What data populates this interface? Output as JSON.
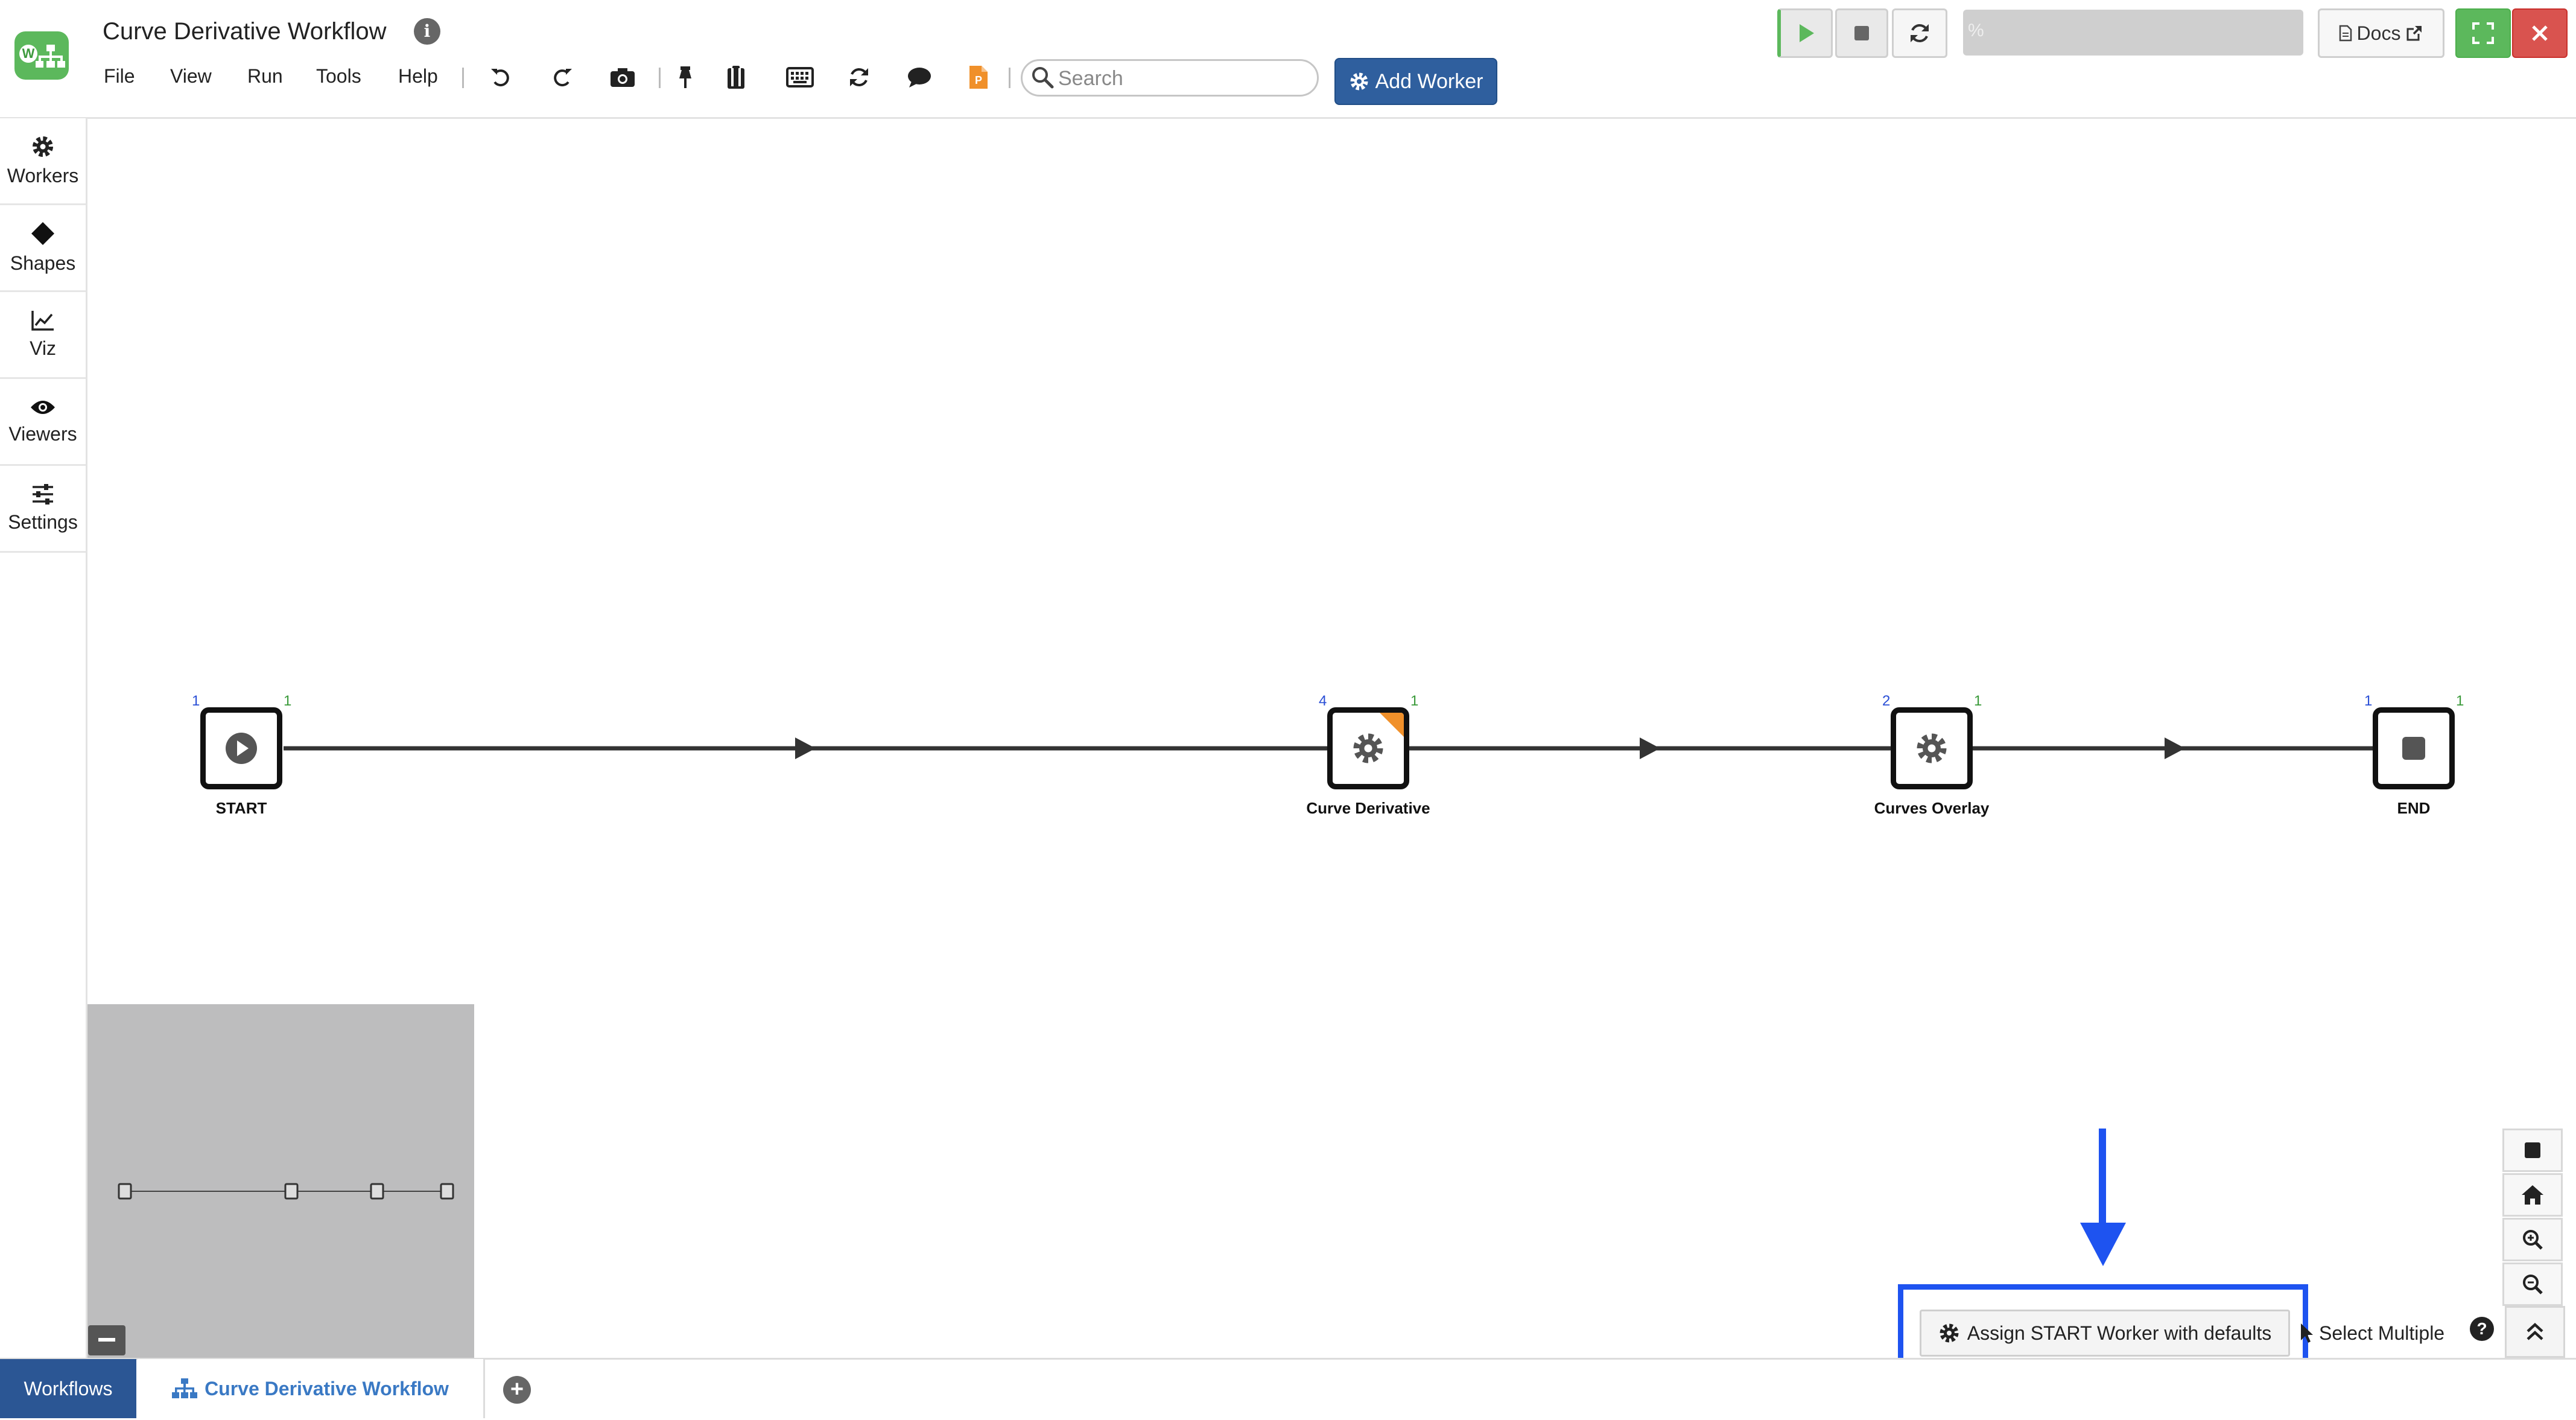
{
  "app": {
    "title": "Curve Derivative Workflow",
    "logo_letter": "W"
  },
  "menu": {
    "items": [
      "File",
      "View",
      "Run",
      "Tools",
      "Help"
    ]
  },
  "toolbar": {
    "icons": [
      "undo-icon",
      "redo-icon",
      "camera-icon",
      "pin-icon",
      "clipboard-icon",
      "keyboard-icon",
      "sync-icon",
      "comment-icon",
      "python-file-icon"
    ],
    "search_placeholder": "Search",
    "add_worker_label": "Add Worker"
  },
  "run_controls": {
    "progress_text": "%",
    "progress_fraction": 0,
    "docs_label": "Docs"
  },
  "sidebar": {
    "items": [
      {
        "label": "Workers",
        "icon": "gear-icon"
      },
      {
        "label": "Shapes",
        "icon": "diamond-icon"
      },
      {
        "label": "Viz",
        "icon": "line-chart-icon"
      },
      {
        "label": "Viewers",
        "icon": "eye-icon"
      },
      {
        "label": "Settings",
        "icon": "sliders-icon"
      }
    ]
  },
  "workflow": {
    "nodes": [
      {
        "label": "START",
        "icon": "play-icon",
        "inputs": "1",
        "outputs": "1",
        "flagged": false
      },
      {
        "label": "Curve Derivative",
        "icon": "gear-icon",
        "inputs": "4",
        "outputs": "1",
        "flagged": true
      },
      {
        "label": "Curves Overlay",
        "icon": "gear-icon",
        "inputs": "2",
        "outputs": "1",
        "flagged": false
      },
      {
        "label": "END",
        "icon": "stop-icon",
        "inputs": "1",
        "outputs": "1",
        "flagged": false
      }
    ],
    "accent_colors": {
      "flag": "#f0902a",
      "inputs": "#2a4fd6",
      "outputs": "#3a9a3a"
    }
  },
  "bottom_actions": {
    "assign_label": "Assign START Worker with defaults",
    "select_multiple_label": "Select Multiple",
    "help_label": "?"
  },
  "annotation": {
    "highlight_color": "#1e53f0"
  },
  "tabs": {
    "workflows_label": "Workflows",
    "current_label": "Curve Derivative Workflow",
    "add_label": "+"
  }
}
